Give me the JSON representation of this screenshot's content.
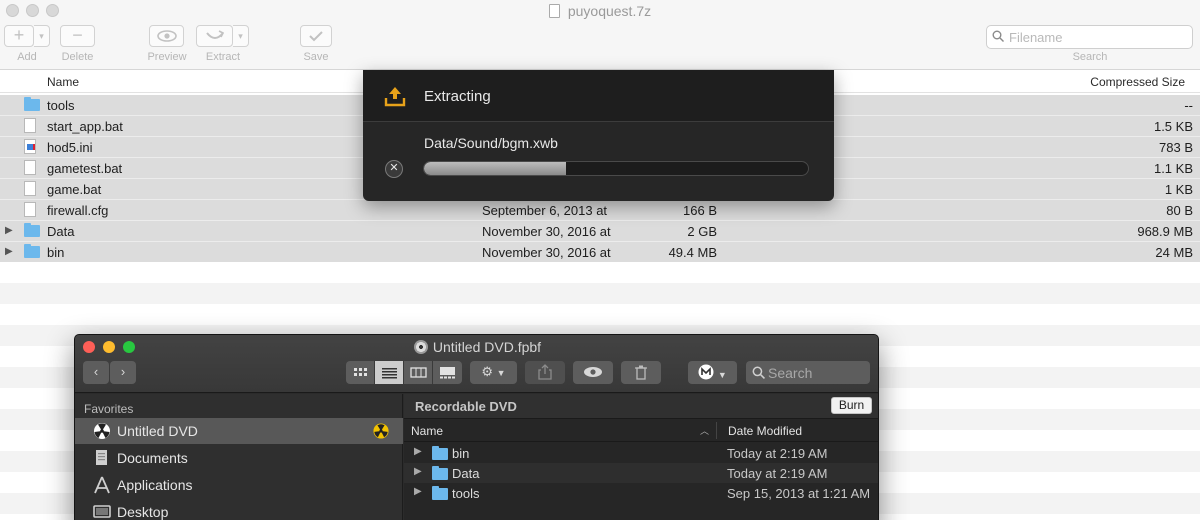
{
  "archive": {
    "title": "puyoquest.7z",
    "toolbar": {
      "add_label": "Add",
      "delete_label": "Delete",
      "preview_label": "Preview",
      "extract_label": "Extract",
      "save_label": "Save",
      "search_placeholder": "Filename",
      "search_label": "Search"
    },
    "columns": {
      "name": "Name",
      "compressed": "Compressed Size"
    },
    "rows": [
      {
        "name": "tools",
        "icon": "folder-icon",
        "date": "",
        "size": "",
        "compressed": "--"
      },
      {
        "name": "start_app.bat",
        "icon": "file-icon",
        "date": "",
        "size": "",
        "compressed": "1.5 KB"
      },
      {
        "name": "hod5.ini",
        "icon": "ini-file-icon",
        "date": "",
        "size": "",
        "compressed": "783 B"
      },
      {
        "name": "gametest.bat",
        "icon": "file-icon",
        "date": "",
        "size": "",
        "compressed": "1.1 KB"
      },
      {
        "name": "game.bat",
        "icon": "file-icon",
        "date": "",
        "size": "",
        "compressed": "1 KB"
      },
      {
        "name": "firewall.cfg",
        "icon": "file-icon",
        "date": "September 6, 2013 at",
        "size": "166 B",
        "compressed": "80 B"
      },
      {
        "name": "Data",
        "icon": "folder-icon",
        "date": "November 30, 2016 at",
        "size": "2 GB",
        "compressed": "968.9 MB"
      },
      {
        "name": "bin",
        "icon": "folder-icon",
        "date": "November 30, 2016 at",
        "size": "49.4 MB",
        "compressed": "24 MB"
      }
    ]
  },
  "extract_panel": {
    "title": "Extracting",
    "current_file": "Data/Sound/bgm.xwb",
    "progress": 0.37
  },
  "finder": {
    "title": "Untitled DVD.fpbf",
    "search_placeholder": "Search",
    "sidebar": {
      "heading": "Favorites",
      "items": [
        {
          "label": "Untitled DVD",
          "icon": "burn-folder-icon"
        },
        {
          "label": "Documents",
          "icon": "documents-icon"
        },
        {
          "label": "Applications",
          "icon": "applications-icon"
        },
        {
          "label": "Desktop",
          "icon": "desktop-icon"
        }
      ]
    },
    "content": {
      "title": "Recordable DVD",
      "burn_label": "Burn",
      "columns": {
        "name": "Name",
        "date": "Date Modified"
      },
      "rows": [
        {
          "name": "bin",
          "date": "Today at 2:19 AM"
        },
        {
          "name": "Data",
          "date": "Today at 2:19 AM"
        },
        {
          "name": "tools",
          "date": "Sep 15, 2013 at 1:21 AM"
        }
      ]
    }
  },
  "colors": {
    "folder": "#6cb8ec",
    "selection_gray": "#dcdcdc",
    "extract_icon": "#e7a21a",
    "finder_red": "#fe5f57",
    "finder_yellow": "#febc2e",
    "finder_green": "#28c840"
  }
}
